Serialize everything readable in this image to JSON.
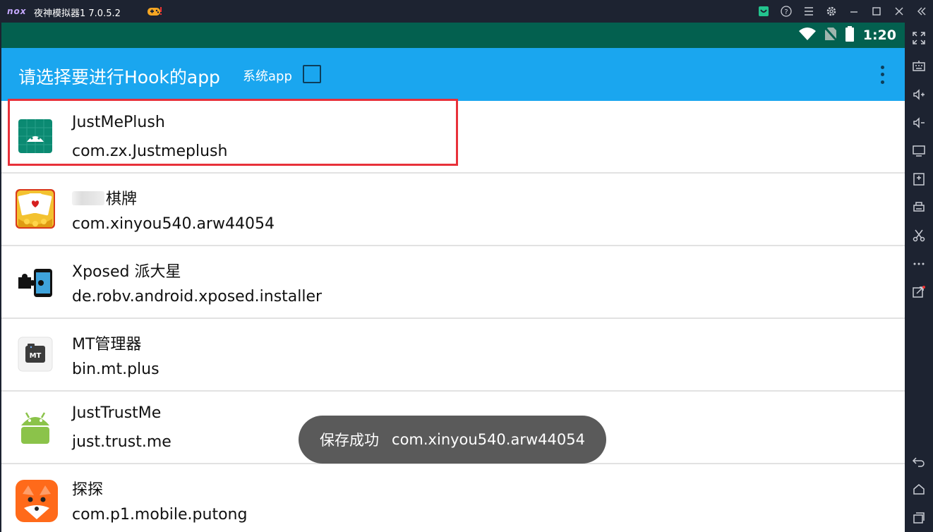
{
  "window": {
    "logo": "nox",
    "title": "夜神模拟器1 7.0.5.2",
    "title_icons": [
      "gamepad-icon",
      "notification-icon",
      "help-icon",
      "menu-icon",
      "settings-icon",
      "minimize-icon",
      "maximize-icon",
      "close-icon",
      "collapse-icon"
    ]
  },
  "statusbar": {
    "time": "1:20",
    "icons": [
      "wifi-icon",
      "no-sim-icon",
      "battery-icon"
    ]
  },
  "appbar": {
    "title": "请选择要进行Hook的app",
    "system_app_label": "系统app",
    "system_app_checked": false
  },
  "apps": [
    {
      "name": "JustMePlush",
      "package": "com.zx.Justmeplush",
      "icon": "android-grid-icon"
    },
    {
      "name": "棋牌",
      "package": "com.xinyou540.arw44054",
      "icon": "poker-cards-icon",
      "name_partially_obscured": true
    },
    {
      "name": "Xposed 派大星",
      "package": "de.robv.android.xposed.installer",
      "icon": "xposed-puzzle-icon"
    },
    {
      "name": "MT管理器",
      "package": "bin.mt.plus",
      "icon": "mt-manager-icon"
    },
    {
      "name": "JustTrustMe",
      "package": "just.trust.me",
      "icon": "android-robot-icon"
    },
    {
      "name": "探探",
      "package": "com.p1.mobile.putong",
      "icon": "fox-icon"
    }
  ],
  "toast": {
    "message": "保存成功",
    "package": "com.xinyou540.arw44054"
  },
  "sidebar_tools": [
    "fullscreen-icon",
    "keyboard-icon",
    "volume-up-icon",
    "volume-down-icon",
    "screen-icon",
    "apk-install-icon",
    "printer-icon",
    "scissors-icon",
    "more-icon",
    "external-link-icon",
    "back-icon",
    "home-icon",
    "recents-icon"
  ],
  "colors": {
    "appbar": "#1aa6ef",
    "statusbar": "#03604f",
    "highlight": "#e8313a",
    "toast": "#5a5a5a"
  }
}
